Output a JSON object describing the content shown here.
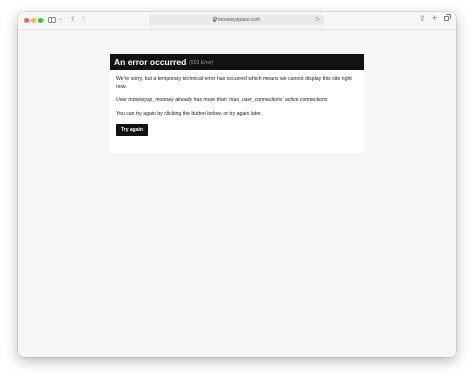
{
  "browser": {
    "url": "mooneyspace.com",
    "icons": {
      "back": "chevron-left-icon",
      "forward": "chevron-right-icon",
      "reload": "reload-icon",
      "share": "share-icon",
      "new_tab": "plus-icon",
      "tabs": "tabs-overview-icon",
      "sidebar": "sidebar-icon",
      "lock": "lock-icon"
    },
    "traffic_lights": [
      "#fe5f57",
      "#febc2e",
      "#28c840"
    ]
  },
  "error": {
    "title": "An error occurred",
    "code": "(503 Error)",
    "message": "We're sorry, but a temporary technical error has occurred which means we cannot display this site right now.",
    "detail": "User mooneysp_mooney already has more than 'max_user_connections' active connections",
    "hint": "You can try again by clicking the button below, or try again later.",
    "button_label": "Try again",
    "header_color": "#121212"
  }
}
